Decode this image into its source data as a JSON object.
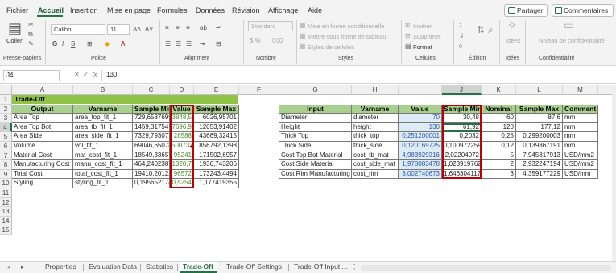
{
  "menu": {
    "tabs": [
      "Fichier",
      "Accueil",
      "Insertion",
      "Mise en page",
      "Formules",
      "Données",
      "Révision",
      "Affichage",
      "Aide"
    ],
    "active": "Accueil",
    "share": "Partager",
    "comments": "Commentaires"
  },
  "ribbon": {
    "clipboard": {
      "paste": "Coller",
      "label": "Presse-papiers"
    },
    "font": {
      "name": "Calibri",
      "size": "11",
      "label": "Police"
    },
    "alignment": {
      "label": "Alignment"
    },
    "number": {
      "format": "Standard",
      "label": "Nombre"
    },
    "styles": {
      "cond": "Mise en forme conditionnelle",
      "table": "Mettre sous forme de tableau",
      "cell": "Styles de cellules",
      "label": "Styles"
    },
    "cells": {
      "insert": "Insérer",
      "delete": "Supprimer",
      "format": "Format",
      "label": "Cellules"
    },
    "editing": {
      "label": "Édition"
    },
    "ideas": {
      "btn": "Idées",
      "label": "Idées"
    },
    "sensitivity": {
      "btn": "Niveau de confidentialité",
      "label": "Confidentialité"
    }
  },
  "formula_bar": {
    "name_box": "J4",
    "value": "130"
  },
  "columns": [
    "A",
    "B",
    "C",
    "D",
    "E",
    "F",
    "G",
    "H",
    "I",
    "J",
    "K",
    "L",
    "M",
    "N"
  ],
  "rows": [
    "1",
    "2",
    "3",
    "4",
    "5",
    "6",
    "7",
    "8",
    "9",
    "10",
    "11",
    "12",
    "13",
    "14",
    "15"
  ],
  "sheet": {
    "title": "Trade-Off",
    "left_headers": [
      "Output",
      "Varname",
      "Sample Min",
      "Value",
      "Sample Max"
    ],
    "left_rows": [
      [
        "Area Top",
        "area_top_fit_1",
        "729,6587699",
        "3848,5",
        "6026,95701"
      ],
      [
        "Area Top Bot",
        "area_tb_fit_1",
        "1459,31754",
        "7696,9",
        "12053,91402"
      ],
      [
        "Area Side",
        "area_side_fit_1",
        "7329,793077",
        "28588",
        "43669,32415"
      ],
      [
        "Volume",
        "vol_fit_1",
        "69046,65078",
        "500733",
        "856792,1398"
      ],
      [
        "Material Cost",
        "mat_cost_fit_1",
        "18549,33657",
        "95241",
        "171502,6957"
      ],
      [
        "Manufacturing Cost",
        "manu_cost_fit_1",
        "464,2402387",
        "1320,7",
        "1936,743206"
      ],
      [
        "Total Cost",
        "total_cost_fit_1",
        "19410,20122",
        "96572",
        "173243,4494"
      ],
      [
        "Styling",
        "styling_fit_1",
        "0,195652174",
        "0,5254",
        "1,177419355"
      ]
    ],
    "right_headers": [
      "Input",
      "Varname",
      "Value",
      "Sample Min",
      "Nominal",
      "Sample Max",
      "Comment"
    ],
    "right_rows": [
      [
        "Diameter",
        "diameter",
        "70",
        "30,48",
        "60",
        "87,6",
        "mm"
      ],
      [
        "Height",
        "height",
        "130",
        "61,92",
        "120",
        "177,12",
        "mm"
      ],
      [
        "Thick Top",
        "thick_top",
        "0,251200001",
        "0,2032",
        "0,25",
        "0,299200003",
        "mm"
      ],
      [
        "Thick Side",
        "thick_side",
        "0,120169725",
        "0,100972259",
        "0,12",
        "0,139367191",
        "mm"
      ],
      [
        "Cost Top Bot Material",
        "cost_tb_mat",
        "4,983929316",
        "2,02204072",
        "5",
        "7,945817913",
        "USD/mm2"
      ],
      [
        "Cost Side Material",
        "cost_side_mat",
        "1,978083478",
        "1,023919762",
        "2",
        "2,932247194",
        "USD/mm2"
      ],
      [
        "Cost Rim Manufacturing",
        "cost_rim",
        "3,002740673",
        "1,646304117",
        "3",
        "4,359177229",
        "USD/mm"
      ]
    ]
  },
  "sheet_tabs": [
    "Properties",
    "Evaluation Data",
    "Statistics",
    "Trade-Off",
    "Trade-Off Settings",
    "Trade-Off Input ..."
  ],
  "active_sheet": "Trade-Off",
  "colors": {
    "accent": "#217346",
    "header_green": "#a9d08e",
    "title_green": "#8fc448",
    "highlight_red": "#c00000",
    "input_blue": "#ddebf7"
  }
}
